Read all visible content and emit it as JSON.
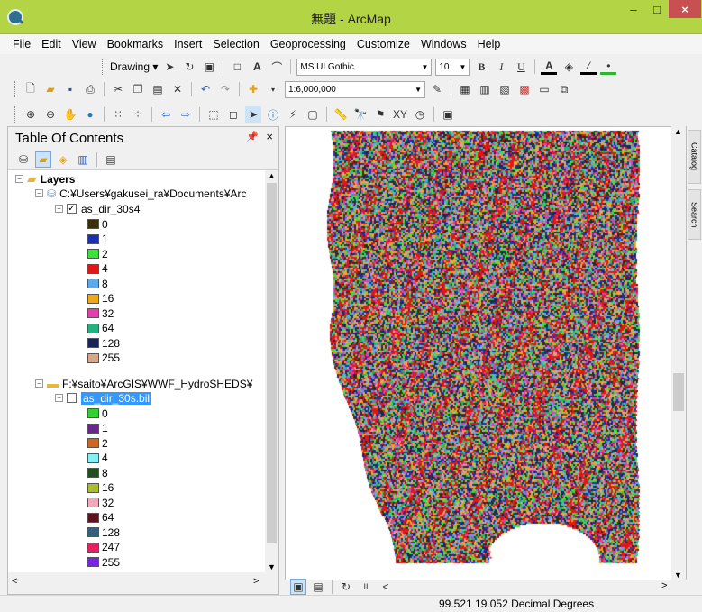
{
  "window": {
    "title": "無題 - ArcMap",
    "minimize": "–",
    "maximize": "□",
    "close": "×"
  },
  "menu": [
    "File",
    "Edit",
    "View",
    "Bookmarks",
    "Insert",
    "Selection",
    "Geoprocessing",
    "Customize",
    "Windows",
    "Help"
  ],
  "toolbar_drawing": {
    "label": "Drawing",
    "font_name": "MS UI Gothic",
    "font_size": "10",
    "bold": "B",
    "italic": "I",
    "underline": "U",
    "text_a": "A"
  },
  "toolbar_standard": {
    "scale": "1:6,000,000"
  },
  "toc": {
    "title": "Table Of Contents",
    "pin": "ᵖ",
    "close": "×",
    "root_label": "Layers",
    "layer1_source": "C:¥Users¥gakusei_ra¥Documents¥Arc",
    "layer1_name": "as_dir_30s4",
    "layer1_classes": [
      "0",
      "1",
      "2",
      "4",
      "8",
      "16",
      "32",
      "64",
      "128",
      "255"
    ],
    "layer2_source": "F:¥saito¥ArcGIS¥WWF_HydroSHEDS¥",
    "layer2_name": "as_dir_30s.bil",
    "layer2_classes": [
      "0",
      "1",
      "2",
      "4",
      "8",
      "16",
      "32",
      "64",
      "128",
      "247",
      "255"
    ]
  },
  "colors": {
    "titlebar": "#b3d445",
    "layer1_swatches": [
      "#3b2e0a",
      "#1a2fb8",
      "#3ae33a",
      "#e01717",
      "#5ea9ea",
      "#f0a818",
      "#e83bb0",
      "#21b27d",
      "#1a2456",
      "#d8a686"
    ],
    "layer2_swatches": [
      "#33d12f",
      "#6a2690",
      "#d0651b",
      "#82f0f6",
      "#204d22",
      "#acbd2e",
      "#f1a8bb",
      "#5c141c",
      "#34607e",
      "#ec1d63",
      "#7a22e6"
    ],
    "raster_palette": [
      "#1a2fb8",
      "#3ae33a",
      "#e01717",
      "#5ea9ea",
      "#f0a818",
      "#e83bb0",
      "#21b27d",
      "#1a2456",
      "#d8a686",
      "#3b2e0a"
    ]
  },
  "side_tabs": {
    "catalog": "Catalog",
    "search": "Search"
  },
  "map_bar": {
    "pause": "II",
    "prev": "<"
  },
  "status": {
    "coordinates": "99.521  19.052 Decimal Degrees"
  }
}
